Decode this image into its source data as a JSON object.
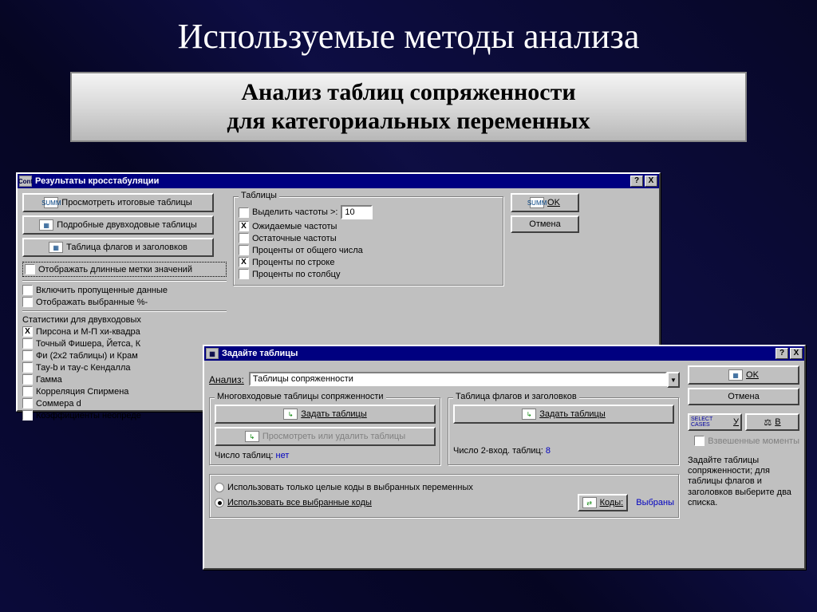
{
  "slide": {
    "title": "Используемые методы анализа",
    "subtitle_l1": "Анализ таблиц сопряженности",
    "subtitle_l2": "для категориальных переменных"
  },
  "win1": {
    "title": "Результаты кросстабуляции",
    "icon": "Cont",
    "help": "?",
    "close": "X",
    "btn_view_summary": "Просмотреть итоговые таблицы",
    "btn_detailed": "Подробные двувходовые таблицы",
    "btn_flags": "Таблица флагов и заголовков",
    "chk_long_labels": "Отображать длинные метки значений",
    "chk_include_missing": "Включить пропущенные данные",
    "chk_show_selected": "Отображать выбранные %-",
    "stats_header": "Статистики для двувходовых",
    "stats": {
      "pearson": "Пирсона и М-П хи-квадра",
      "fisher": "Точный Фишера, Йетса, К",
      "phi": "Фи (2x2 таблицы) и Крам",
      "tau": "Тау-b и тау-c Кендалла",
      "gamma": "Гамма",
      "spearman": "Корреляция Спирмена",
      "sommer": "Соммера d",
      "coef": "Коэффициенты неопреде"
    },
    "tables_group": "Таблицы",
    "highlight_freq": "Выделить частоты >:",
    "highlight_val": "10",
    "expected": "Ожидаемые частоты",
    "residual": "Остаточные частоты",
    "pct_total": "Проценты от общего числа",
    "pct_row": "Проценты по строке",
    "pct_col": "Проценты по столбцу",
    "btn_ok": "OK",
    "btn_cancel": "Отмена"
  },
  "win2": {
    "title": "Задайте таблицы",
    "analysis_label": "Анализ:",
    "analysis_value": "Таблицы сопряженности",
    "multi_group": "Многовходовые таблицы сопряженности",
    "btn_set_tables": "Задать таблицы",
    "btn_view_del": "Просмотреть или удалить таблицы",
    "tbl_count_label": "Число таблиц:",
    "tbl_count_val": "нет",
    "flags_group": "Таблица флагов и заголовков",
    "btn_set_tables2": "Задать таблицы",
    "twoway_label": "Число 2-вход. таблиц:",
    "twoway_val": "8",
    "radio_int": "Использовать только целые коды в выбранных переменных",
    "radio_all": "Использовать все выбранные коды",
    "btn_codes": "Коды:",
    "codes_val": "Выбраны",
    "btn_ok": "OK",
    "btn_cancel": "Отмена",
    "btn_cases_label": "SELECT CASES",
    "btn_cases": "У",
    "btn_b": "B",
    "chk_weighted": "Взвешенные моменты",
    "help_text": "Задайте таблицы сопряженности; для таблицы флагов и заголовков выберите два списка."
  }
}
